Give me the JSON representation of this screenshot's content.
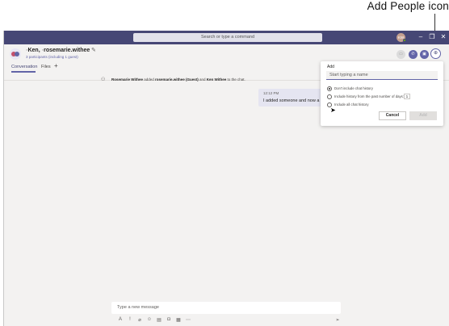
{
  "callout": {
    "label": "Add People icon"
  },
  "titlebar": {
    "search_placeholder": "Search or type a command",
    "avatar_initials": "KW",
    "minimize": "–",
    "maximize": "❐",
    "close": "✕"
  },
  "chat": {
    "participant_1": "Ken,",
    "participant_2": "rosemarie.withee",
    "participants_summary": "3 participants (including 1 guest)",
    "tabs": [
      "Conversation",
      "Files"
    ],
    "add_tab": "+"
  },
  "messages": {
    "system": {
      "actor": "Rosemarie Withee",
      "verb": " added ",
      "target": "rosemarie.withee (Guest)",
      "conj": " and ",
      "target2": "Ken Withee",
      "tail": " to the chat."
    },
    "bubble": {
      "time": "12:12 PM",
      "text": "I added someone and now a n"
    }
  },
  "add_panel": {
    "title": "Add",
    "input_placeholder": "Start typing a name",
    "options": [
      {
        "label": "Don't include chat history",
        "selected": true
      },
      {
        "label": "Include history from the past number of days:",
        "selected": false
      },
      {
        "label": "Include all chat history",
        "selected": false
      }
    ],
    "days_value": "1",
    "cancel_label": "Cancel",
    "add_label": "Add"
  },
  "compose": {
    "placeholder": "Type a new message",
    "icons": [
      "format-icon",
      "important-icon",
      "attach-icon",
      "emoji-icon",
      "gif-icon",
      "sticker-icon",
      "meet-icon",
      "more-icon"
    ],
    "send_icon": "send-icon"
  },
  "colors": {
    "titlebar": "#464775",
    "accent": "#6264a7",
    "background": "#f3f2f1"
  }
}
